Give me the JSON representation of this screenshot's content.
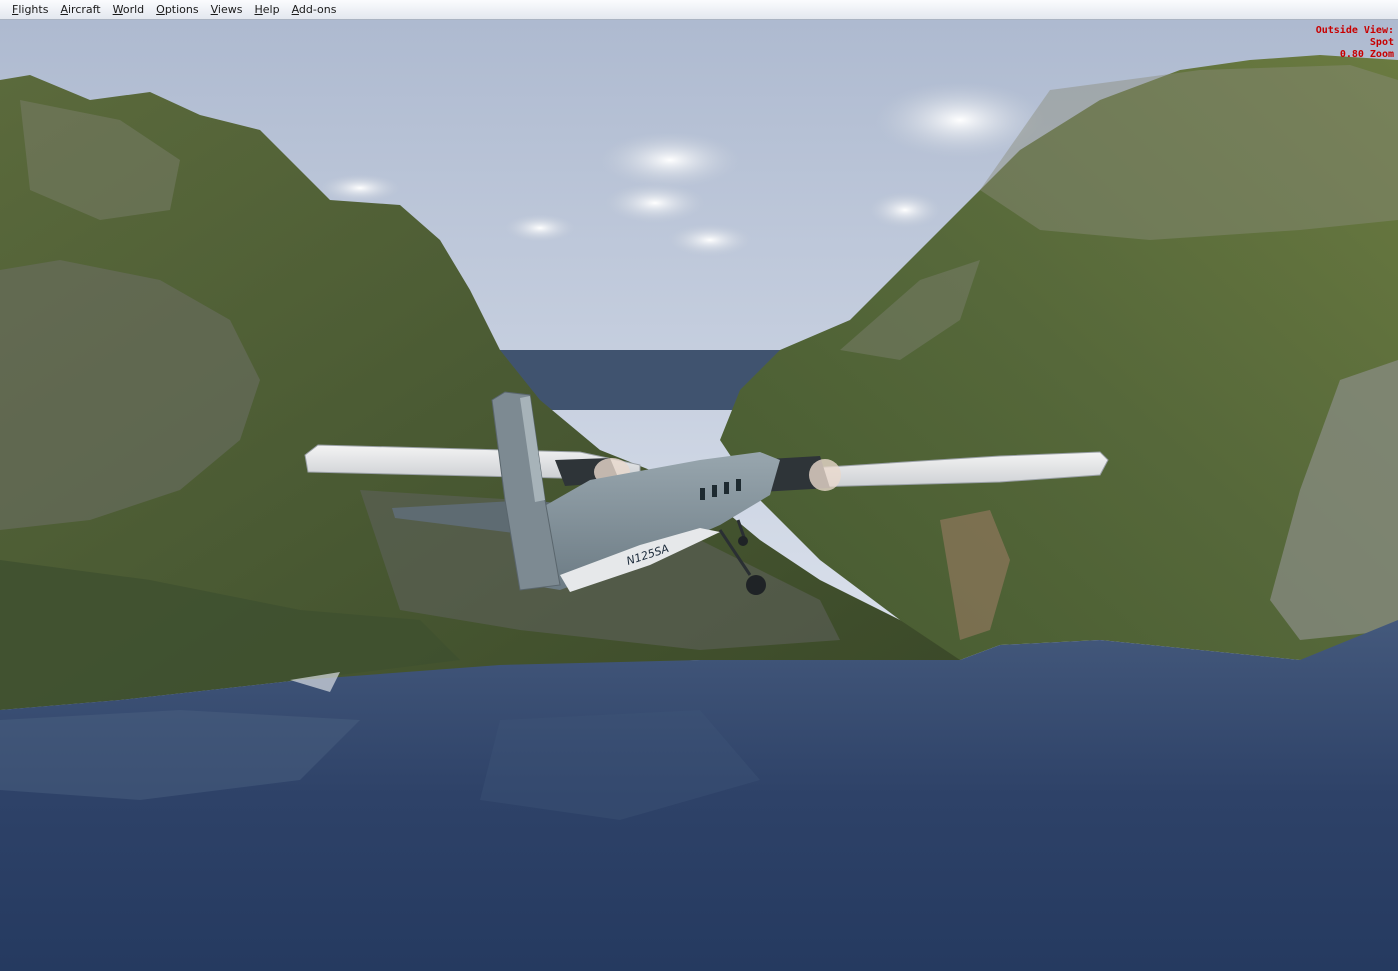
{
  "menu": {
    "items": [
      "Flights",
      "Aircraft",
      "World",
      "Options",
      "Views",
      "Help",
      "Add-ons"
    ]
  },
  "hud": {
    "line1": "Outside View:",
    "line2": "Spot",
    "line3": "0.80 Zoom",
    "color": "#c80000"
  },
  "aircraft": {
    "registration": "N125SA"
  }
}
